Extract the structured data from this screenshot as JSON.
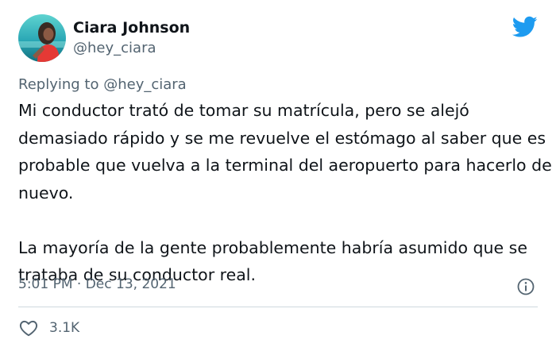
{
  "author": {
    "name": "Ciara Johnson",
    "handle": "@hey_ciara"
  },
  "reply": {
    "prefix": "Replying to",
    "handle": "@hey_ciara"
  },
  "body": {
    "paragraph_1": "Mi conductor trató de tomar su matrícula, pero se alejó demasiado rápido y se me revuelve el estómago al saber que es probable que vuelva a la terminal del aeropuerto para hacerlo de nuevo.",
    "paragraph_2": "La mayoría de la gente probablemente habría asumido que se trataba de su conductor real."
  },
  "meta": {
    "time": "5:01 PM",
    "separator": "·",
    "date": "Dec 13, 2021"
  },
  "stats": {
    "likes": "3.1K"
  },
  "icons": {
    "brand": "twitter-bird-icon",
    "info": "info-icon",
    "like": "heart-icon"
  },
  "colors": {
    "brand_blue": "#1d9bf0",
    "text_primary": "#0f1419",
    "text_secondary": "#536471",
    "divider": "#cfd9de"
  }
}
